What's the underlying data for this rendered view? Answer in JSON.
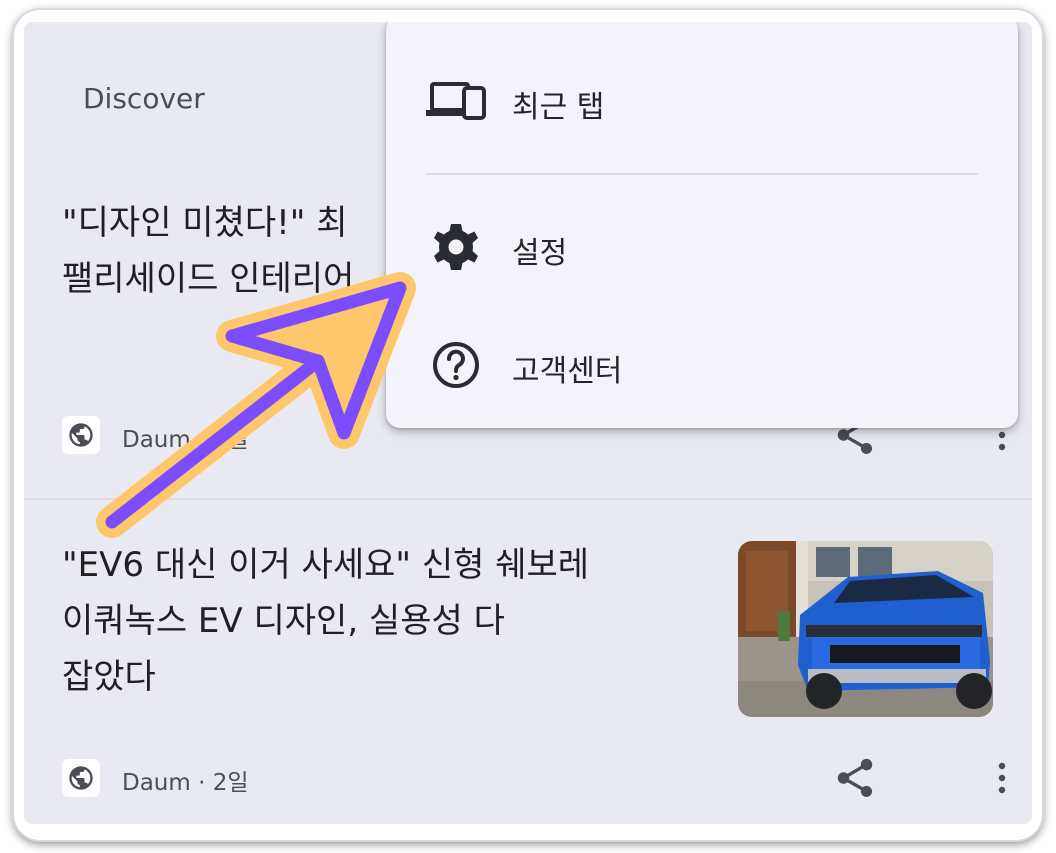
{
  "feed": {
    "section_title": "Discover",
    "cards": [
      {
        "headline_lines": [
          "\"디자인 미쳤다!\" 최",
          "팰리세이드 인테리어"
        ],
        "source": "Daum",
        "source_meta": "Daum · 2일"
      },
      {
        "headline_lines": [
          "\"EV6 대신 이거 사세요\" 신형 쉐보레",
          "이쿼녹스 EV 디자인, 실용성 다",
          "잡았다"
        ],
        "source": "Daum",
        "source_meta": "Daum · 2일",
        "thumbnail": "blue-electric-suv-photo"
      }
    ]
  },
  "menu": {
    "items": [
      {
        "label": "최근 탭",
        "icon": "devices-icon"
      },
      {
        "label": "설정",
        "icon": "gear-icon"
      },
      {
        "label": "고객센터",
        "icon": "help-circle-icon"
      }
    ]
  },
  "icons": [
    "globe-icon",
    "share-icon",
    "more-vert-icon",
    "devices-icon",
    "gear-icon",
    "help-circle-icon"
  ],
  "colors": {
    "background": "#e9eaf1",
    "menu_background": "#f3f3f9",
    "annotation_arrow_fill": "#7c4dff",
    "annotation_arrow_glow": "#ffc76b"
  }
}
